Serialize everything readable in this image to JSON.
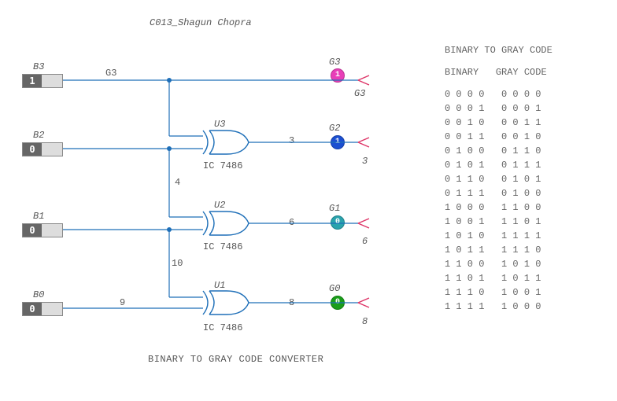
{
  "title": "C013_Shagun Chopra",
  "footer": "BINARY TO GRAY CODE CONVERTER",
  "inputs": {
    "B3": {
      "name": "B3",
      "value": "1"
    },
    "B2": {
      "name": "B2",
      "value": "0"
    },
    "B1": {
      "name": "B1",
      "value": "0"
    },
    "B0": {
      "name": "B0",
      "value": "0"
    }
  },
  "gates": {
    "U3": {
      "name": "U3",
      "chip": "IC 7486"
    },
    "U2": {
      "name": "U2",
      "chip": "IC 7486"
    },
    "U1": {
      "name": "U1",
      "chip": "IC 7486"
    }
  },
  "wires": {
    "w_G3": "G3",
    "w_3": "3",
    "w_4": "4",
    "w_6": "6",
    "w_10": "10",
    "w_8": "8",
    "w_9": "9"
  },
  "probes": {
    "G3": {
      "name": "G3",
      "value": "1",
      "color": "#e83fb8",
      "out_label": "G3"
    },
    "G2": {
      "name": "G2",
      "value": "1",
      "color": "#1b4fd1",
      "out_label": "3"
    },
    "G1": {
      "name": "G1",
      "value": "0",
      "color": "#2aa3ad",
      "out_label": "6"
    },
    "G0": {
      "name": "G0",
      "value": "0",
      "color": "#1a9e1a",
      "out_label": "8"
    }
  },
  "table": {
    "title": "BINARY TO GRAY CODE",
    "col_binary": "BINARY",
    "col_gray": "GRAY CODE",
    "rows": [
      {
        "b": "0 0 0 0",
        "g": "0 0 0 0"
      },
      {
        "b": "0 0 0 1",
        "g": "0 0 0 1"
      },
      {
        "b": "0 0 1 0",
        "g": "0 0 1 1"
      },
      {
        "b": "0 0 1 1",
        "g": "0 0 1 0"
      },
      {
        "b": "0 1 0 0",
        "g": "0 1 1 0"
      },
      {
        "b": "0 1 0 1",
        "g": "0 1 1 1"
      },
      {
        "b": "0 1 1 0",
        "g": "0 1 0 1"
      },
      {
        "b": "0 1 1 1",
        "g": "0 1 0 0"
      },
      {
        "b": "1 0 0 0",
        "g": "1 1 0 0"
      },
      {
        "b": "1 0 0 1",
        "g": "1 1 0 1"
      },
      {
        "b": "1 0 1 0",
        "g": "1 1 1 1"
      },
      {
        "b": "1 0 1 1",
        "g": "1 1 1 0"
      },
      {
        "b": "1 1 0 0",
        "g": "1 0 1 0"
      },
      {
        "b": "1 1 0 1",
        "g": "1 0 1 1"
      },
      {
        "b": "1 1 1 0",
        "g": "1 0 0 1"
      },
      {
        "b": "1 1 1 1",
        "g": "1 0 0 0"
      }
    ]
  },
  "chart_data": {
    "type": "table",
    "title": "BINARY TO GRAY CODE",
    "columns": [
      "BINARY",
      "GRAY CODE"
    ],
    "rows": [
      [
        "0000",
        "0000"
      ],
      [
        "0001",
        "0001"
      ],
      [
        "0010",
        "0011"
      ],
      [
        "0011",
        "0010"
      ],
      [
        "0100",
        "0110"
      ],
      [
        "0101",
        "0111"
      ],
      [
        "0110",
        "0101"
      ],
      [
        "0111",
        "0100"
      ],
      [
        "1000",
        "1100"
      ],
      [
        "1001",
        "1101"
      ],
      [
        "1010",
        "1111"
      ],
      [
        "1011",
        "1110"
      ],
      [
        "1100",
        "1010"
      ],
      [
        "1101",
        "1011"
      ],
      [
        "1110",
        "1001"
      ],
      [
        "1111",
        "1000"
      ]
    ]
  }
}
